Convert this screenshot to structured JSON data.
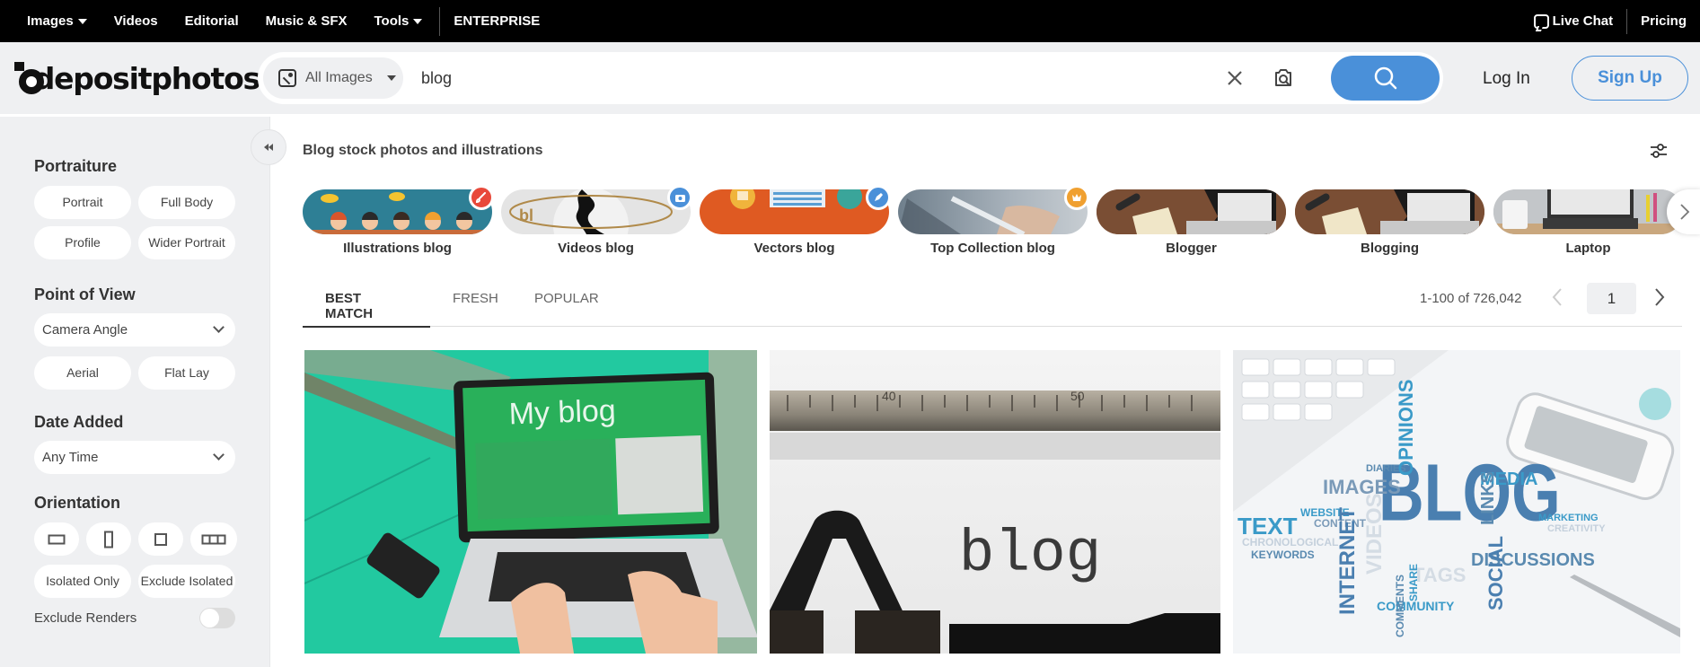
{
  "topnav": {
    "items": [
      {
        "label": "Images",
        "has_caret": true
      },
      {
        "label": "Videos"
      },
      {
        "label": "Editorial"
      },
      {
        "label": "Music & SFX"
      },
      {
        "label": "Tools",
        "has_caret": true
      }
    ],
    "enterprise": "ENTERPRISE",
    "live_chat": "Live Chat",
    "pricing": "Pricing"
  },
  "header": {
    "logo_text": "depositphotos",
    "search": {
      "type_label": "All Images",
      "query": "blog",
      "placeholder": ""
    },
    "login": "Log In",
    "signup": "Sign Up",
    "colors": {
      "accent": "#4a90d9"
    }
  },
  "sidebar": {
    "portraiture": {
      "title": "Portraiture",
      "options": [
        "Portrait",
        "Full Body",
        "Profile",
        "Wider Portrait"
      ]
    },
    "point_of_view": {
      "title": "Point of View",
      "dropdown": "Camera Angle",
      "options": [
        "Aerial",
        "Flat Lay"
      ]
    },
    "date_added": {
      "title": "Date Added",
      "dropdown": "Any Time"
    },
    "orientation": {
      "title": "Orientation",
      "icons": [
        "horizontal-orientation",
        "vertical-orientation",
        "square-orientation",
        "panoramic-orientation"
      ],
      "isolated": [
        "Isolated Only",
        "Exclude Isolated"
      ]
    },
    "exclude_renders": {
      "label": "Exclude Renders",
      "enabled": false
    }
  },
  "main": {
    "title": "Blog stock photos and illustrations",
    "categories": [
      {
        "label": "Illustrations blog",
        "badge": "brush",
        "badge_color": "#e8493a"
      },
      {
        "label": "Videos blog",
        "badge": "camera",
        "badge_color": "#4a90d9"
      },
      {
        "label": "Vectors blog",
        "badge": "pen",
        "badge_color": "#4a90d9"
      },
      {
        "label": "Top Collection blog",
        "badge": "crown",
        "badge_color": "#f0a030"
      },
      {
        "label": "Blogger"
      },
      {
        "label": "Blogging"
      },
      {
        "label": "Laptop"
      }
    ],
    "tabs": [
      "BEST MATCH",
      "FRESH",
      "POPULAR"
    ],
    "active_tab": "BEST MATCH",
    "results_count": "1-100 of 726,042",
    "page": "1",
    "results": [
      {
        "alt": "Laptop showing My blog page on green table",
        "screen_text": "My blog"
      },
      {
        "alt": "Typewriter typing blog",
        "screen_text": "blog"
      },
      {
        "alt": "Blog word cloud with keyboard, phone and pen",
        "screen_text": "BLOG"
      }
    ]
  }
}
